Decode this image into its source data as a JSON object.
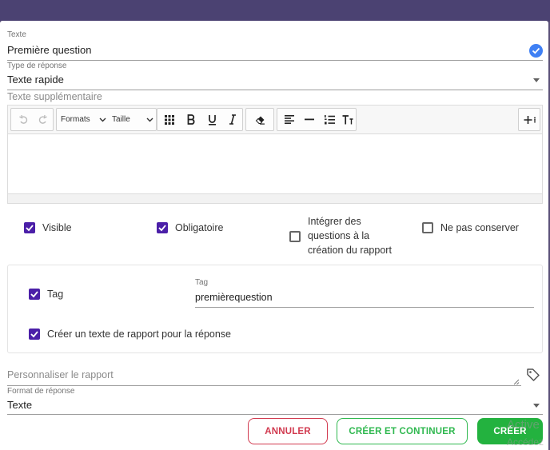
{
  "question_text": {
    "label": "Texte",
    "value": "Première question"
  },
  "response_type": {
    "label": "Type de réponse",
    "value": "Texte rapide"
  },
  "extra_text": {
    "label": "Texte supplémentaire",
    "toolbar": {
      "formats_label": "Formats",
      "size_label": "Taille"
    }
  },
  "options": {
    "visible": {
      "label": "Visible",
      "checked": true
    },
    "mandatory": {
      "label": "Obligatoire",
      "checked": true
    },
    "integrate": {
      "label_lines": [
        "Intégrer des",
        "questions à la",
        "création du rapport"
      ],
      "checked": false
    },
    "no_keep": {
      "label": "Ne pas conserver",
      "checked": false
    }
  },
  "tag_panel": {
    "tag_checkbox_label": "Tag",
    "tag_field_label": "Tag",
    "tag_field_value": "premièrequestion",
    "report_text_label": "Créer un texte de rapport pour la réponse"
  },
  "customize_report": {
    "placeholder": "Personnaliser le rapport"
  },
  "response_format": {
    "label": "Format de réponse",
    "value": "Texte"
  },
  "actions": {
    "cancel": "ANNULER",
    "create_continue": "CRÉER ET CONTINUER",
    "create": "CRÉER"
  },
  "watermark": {
    "line1": "Active",
    "line2": "Accédez"
  },
  "colors": {
    "accent_purple": "#4b1fa8",
    "cancel_red": "#d13a4f",
    "create_green": "#23b23f",
    "check_blue": "#3f80f4"
  }
}
